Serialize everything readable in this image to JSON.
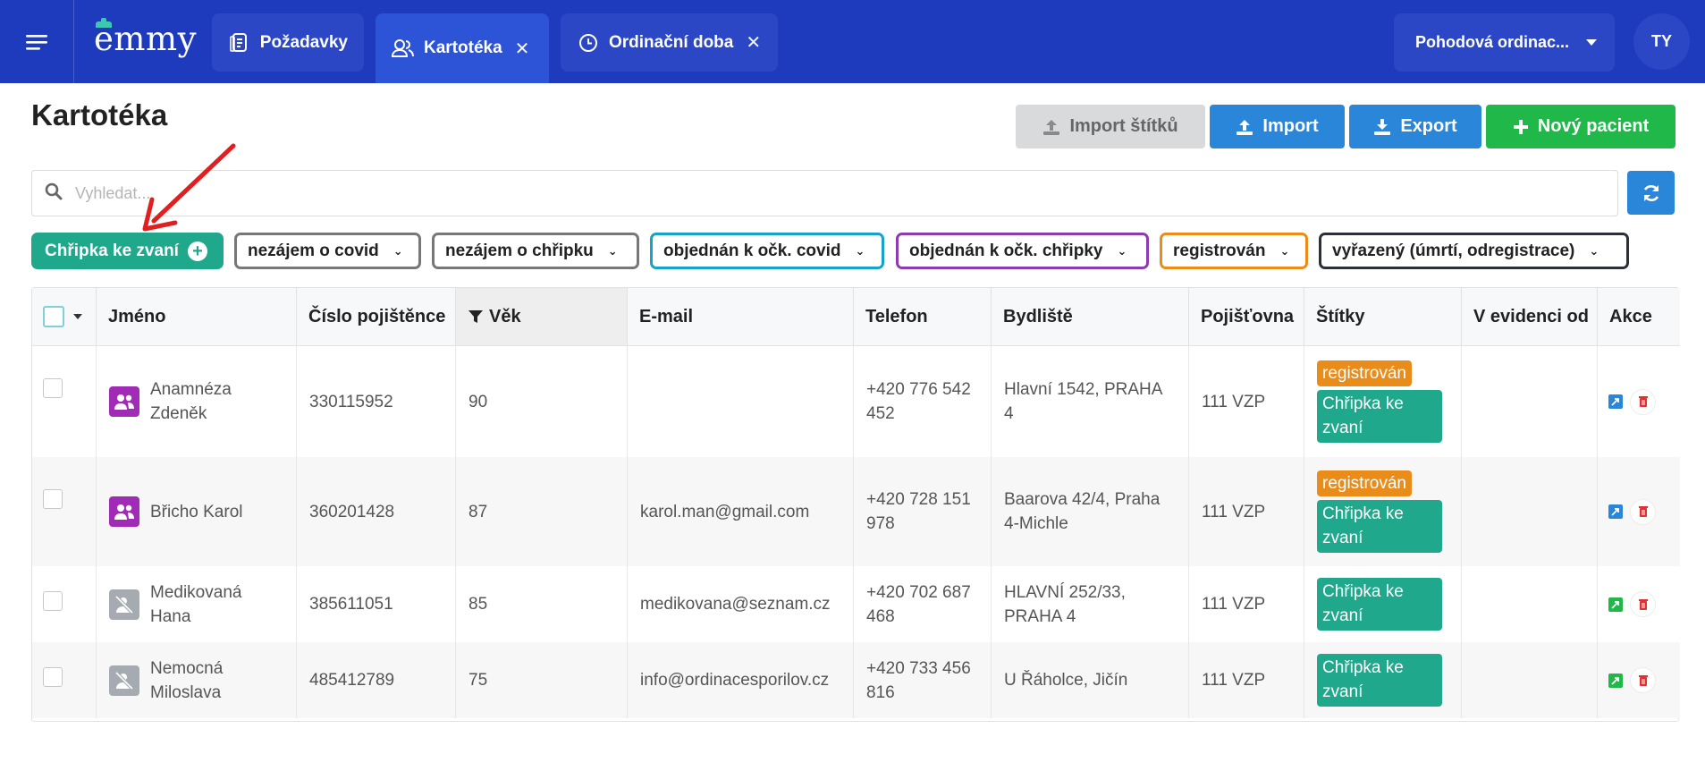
{
  "app": {
    "logo_text": "emmy",
    "avatar_initials": "TY"
  },
  "tabs": [
    {
      "label": "Požadavky",
      "icon": "document-icon",
      "closable": false
    },
    {
      "label": "Kartotéka",
      "icon": "users-icon",
      "closable": true,
      "active": true
    },
    {
      "label": "Ordinační doba",
      "icon": "clock-icon",
      "closable": true
    }
  ],
  "org_select": {
    "value": "Pohodová ordinac..."
  },
  "page": {
    "title": "Kartotéka",
    "buttons": {
      "import_tags": "Import štítků",
      "import": "Import",
      "export": "Export",
      "new_patient": "Nový pacient"
    },
    "search": {
      "placeholder": "Vyhledat..."
    }
  },
  "filters": [
    {
      "label": "Chřipka ke zvaní",
      "color": "#1fa88b",
      "selected": true
    },
    {
      "label": "nezájem o covid",
      "color": "#777777"
    },
    {
      "label": "nezájem o chřipku",
      "color": "#777777"
    },
    {
      "label": "objednán k očk. covid",
      "color": "#17a2c8"
    },
    {
      "label": "objednán k očk. chřipky",
      "color": "#8d3bb0"
    },
    {
      "label": "registrován",
      "color": "#ea8c1a"
    },
    {
      "label": "vyřazený (úmrtí, odregistrace)",
      "color": "#2a2f3a"
    }
  ],
  "table": {
    "columns": [
      "Jméno",
      "Číslo pojištěnce",
      "Věk",
      "E-mail",
      "Telefon",
      "Bydliště",
      "Pojišťovna",
      "Štítky",
      "V evidenci od",
      "Akce"
    ],
    "rows": [
      {
        "name": "Anamnéza Zdeněk",
        "insurance_no": "330115952",
        "age": "90",
        "email": "",
        "phone": "+420 776 542 452",
        "address": "Hlavní 1542, PRAHA 4",
        "insurer": "111 VZP",
        "tags": [
          "registrován",
          "Chřipka ke zvaní"
        ],
        "since": "",
        "avatar": "purple"
      },
      {
        "name": "Břicho Karol",
        "insurance_no": "360201428",
        "age": "87",
        "email": "karol.man@gmail.com",
        "phone": "+420 728 151 978",
        "address": "Baarova 42/4, Praha 4-Michle",
        "insurer": "111 VZP",
        "tags": [
          "registrován",
          "Chřipka ke zvaní"
        ],
        "since": "",
        "avatar": "purple"
      },
      {
        "name": "Medikovaná Hana",
        "insurance_no": "385611051",
        "age": "85",
        "email": "medikovana@seznam.cz",
        "phone": "+420 702 687 468",
        "address": "HLAVNÍ 252/33, PRAHA 4",
        "insurer": "111 VZP",
        "tags": [
          "Chřipka ke zvaní"
        ],
        "since": "",
        "avatar": "grey"
      },
      {
        "name": "Nemocná Miloslava",
        "insurance_no": "485412789",
        "age": "75",
        "email": "info@ordinacesporilov.cz",
        "phone": "+420 733 456 816",
        "address": "U Řáholce, Jičín",
        "insurer": "111 VZP",
        "tags": [
          "Chřipka ke zvaní"
        ],
        "since": "",
        "avatar": "grey"
      }
    ]
  }
}
